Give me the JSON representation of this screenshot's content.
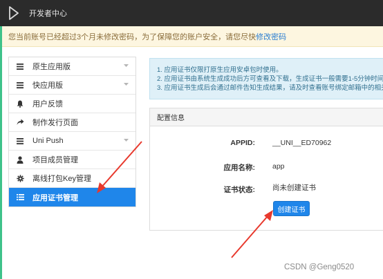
{
  "header": {
    "title": "开发者中心",
    "logo_icon": "play-bracket-icon"
  },
  "notice": {
    "text": "您当前账号已经超过3个月未修改密码，为了保障您的账户安全，请您尽快",
    "link": "修改密码"
  },
  "sidebar": {
    "items": [
      {
        "label": "原生应用版",
        "icon": "menu-lines-icon",
        "has_chevron": true
      },
      {
        "label": "快应用版",
        "icon": "menu-lines-icon",
        "has_chevron": true
      },
      {
        "label": "用户反馈",
        "icon": "bell-icon",
        "has_chevron": false
      },
      {
        "label": "制作发行页面",
        "icon": "share-arrow-icon",
        "has_chevron": false
      },
      {
        "label": "Uni Push",
        "icon": "menu-lines-icon",
        "has_chevron": true
      },
      {
        "label": "项目成员管理",
        "icon": "user-icon",
        "has_chevron": false
      },
      {
        "label": "离线打包Key管理",
        "icon": "gear-icon",
        "has_chevron": false
      },
      {
        "label": "应用证书管理",
        "icon": "list-icon",
        "has_chevron": false,
        "active": true
      }
    ]
  },
  "info": {
    "lines": [
      "1. 应用证书仅限打原生应用安卓包时使用。",
      "2. 应用证书由系统生成成功后方可查看及下载，生成证书一般需要1-5分钟时间，",
      "3. 应用证书生成后会通过邮件告知生成结果，请及时查看账号绑定邮箱中的相关邮"
    ]
  },
  "config": {
    "title": "配置信息",
    "appid_label": "APPID:",
    "appid_value": "__UNI__ED70962",
    "appname_label": "应用名称:",
    "appname_value": "app",
    "status_label": "证书状态:",
    "status_value": "尚未创建证书",
    "create_button": "创建证书"
  },
  "watermark": "CSDN @Geng0520",
  "colors": {
    "accent": "#1f86ea",
    "topbar": "#2b2b2b",
    "arrow": "#e8392d",
    "notice_bg": "#fdf6e0"
  }
}
